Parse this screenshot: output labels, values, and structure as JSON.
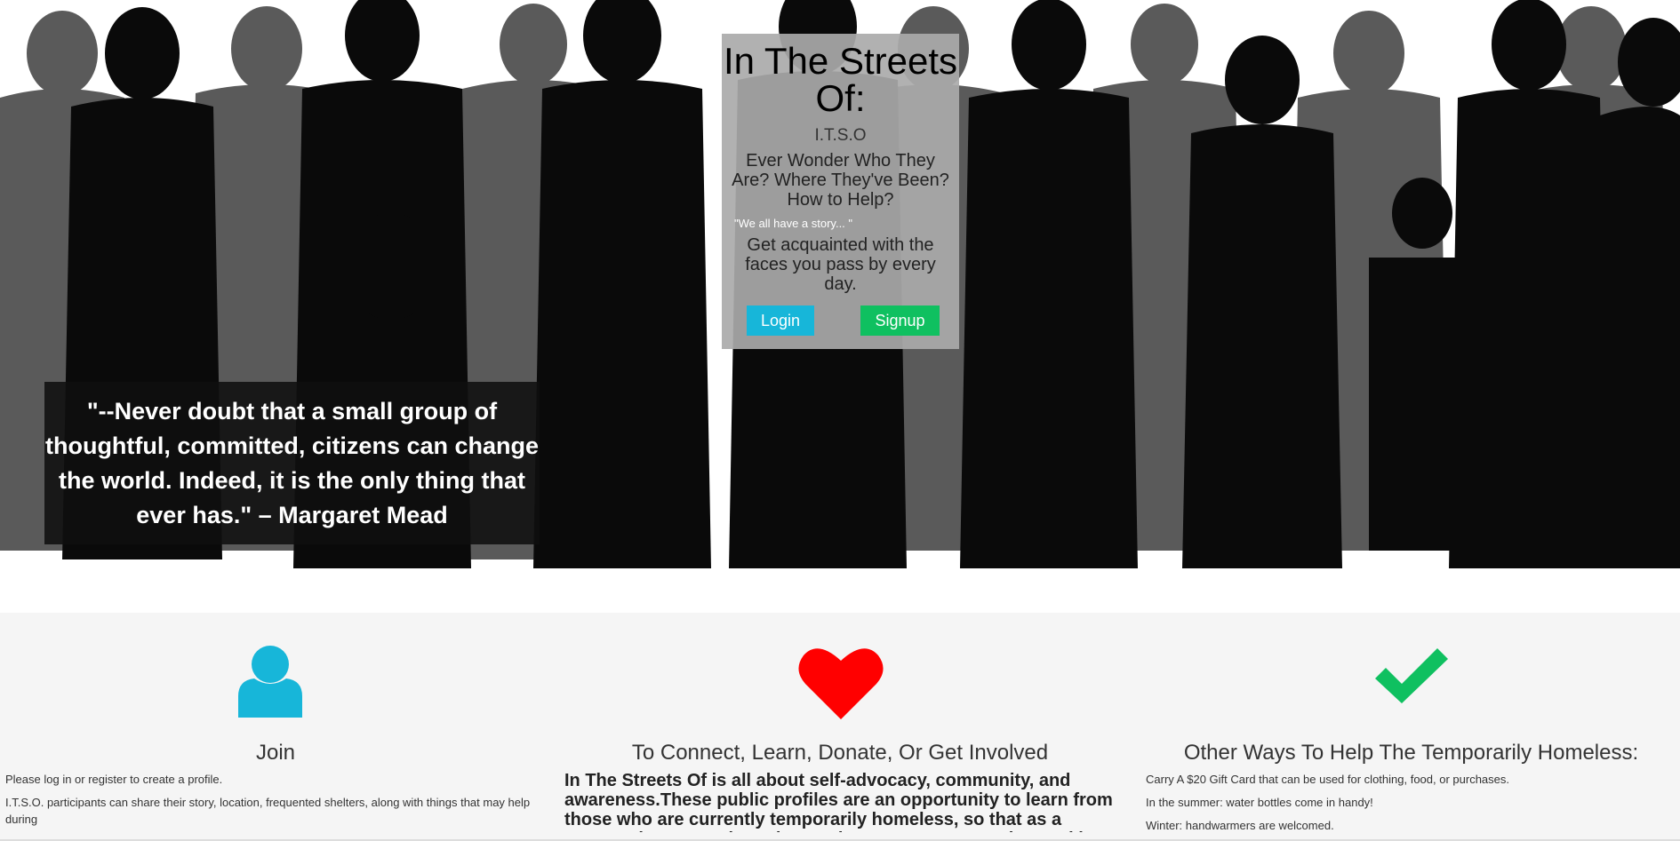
{
  "hero": {
    "title": "In The Streets Of:",
    "acronym": "I.T.S.O",
    "question": "Ever Wonder Who They Are? Where They've Been? How to Help?",
    "story": "\"We all have a story... \"",
    "tagline": "Get acquainted with the faces you pass by every day.",
    "login_label": "Login",
    "signup_label": "Signup",
    "quote": "\"--Never doubt that a small group of thoughtful, committed, citizens can change the world. Indeed, it is the only thing that ever has.\" – Margaret Mead"
  },
  "features": {
    "join": {
      "icon": "user-icon",
      "title": "Join",
      "lines": [
        "Please log in or register to create a profile.",
        "I.T.S.O. participants can share their story, location, frequented shelters, along with things that may help during"
      ]
    },
    "connect": {
      "icon": "heart-icon",
      "title": "To Connect, Learn, Donate, Or Get Involved",
      "text": "In The Streets Of is all about self-advocacy, community, and awareness.These public profiles are an opportunity to learn from those who are currently temporarily homeless, so that as a community we can learn how to improve How We Help. Working"
    },
    "help": {
      "icon": "check-icon",
      "title": "Other Ways To Help The Temporarily Homeless:",
      "lines": [
        "Carry A $20 Gift Card that can be used for clothing, food, or purchases.",
        "In the summer: water bottles come in handy!",
        "Winter: handwarmers are welcomed."
      ]
    }
  },
  "colors": {
    "login": "#17b6d9",
    "signup": "#0fc060",
    "user_icon": "#17b6d9",
    "heart_icon": "#ff0000",
    "check_icon": "#0fc060"
  }
}
